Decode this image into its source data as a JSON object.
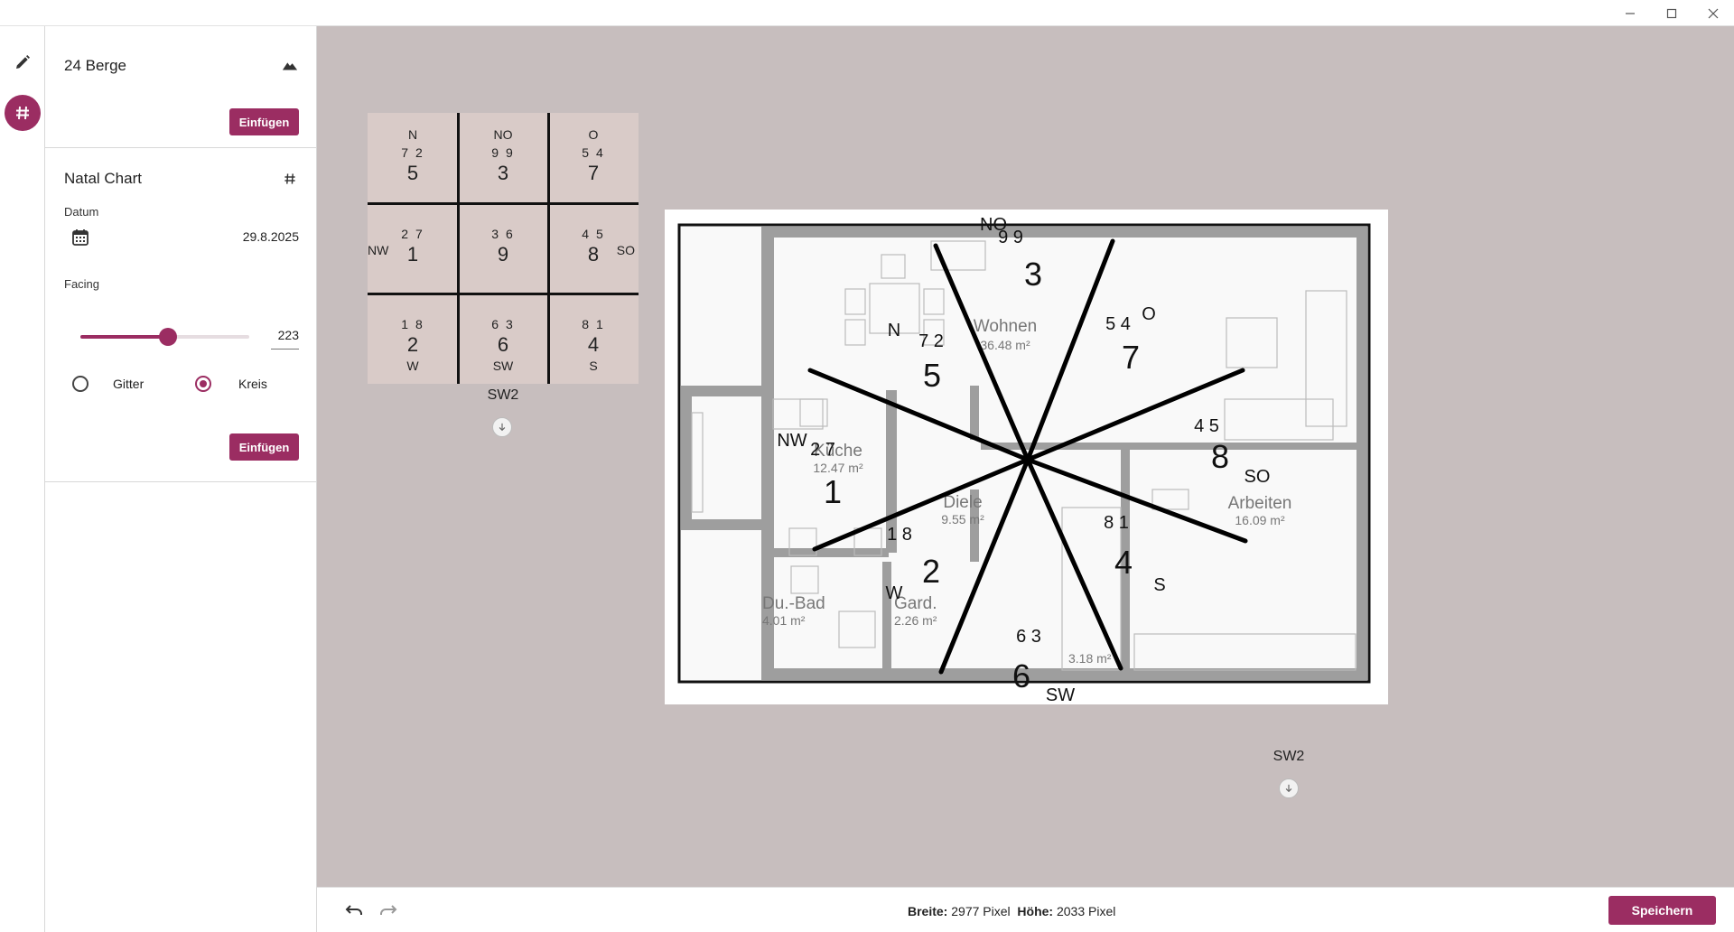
{
  "window": {
    "minimize_icon": "minimize-icon",
    "maximize_icon": "maximize-icon",
    "close_icon": "close-icon"
  },
  "rail": {
    "items": [
      {
        "icon": "pencil-icon",
        "active": false
      },
      {
        "icon": "hashtag-icon",
        "active": true
      }
    ]
  },
  "panel": {
    "berge": {
      "title": "24 Berge",
      "icon": "mountain-icon",
      "insert_label": "Einfügen"
    },
    "natal": {
      "title": "Natal Chart",
      "icon": "hashtag-icon",
      "date_label": "Datum",
      "date_value": "29.8.2025",
      "calendar_icon": "calendar-icon",
      "facing_label": "Facing",
      "facing_value": "223",
      "facing_fraction": 0.52,
      "radio_grid_label": "Gitter",
      "radio_circle_label": "Kreis",
      "selected": "Kreis",
      "insert_label": "Einfügen"
    }
  },
  "grid_chart": {
    "caption": "SW2",
    "cells": [
      {
        "dir": "N",
        "small": "7 2",
        "big": "5"
      },
      {
        "dir": "NO",
        "small": "9 9",
        "big": "3"
      },
      {
        "dir": "O",
        "small": "5 4",
        "big": "7"
      },
      {
        "side_left": "NW",
        "small": "2 7",
        "big": "1"
      },
      {
        "small": "3 6",
        "big": "9"
      },
      {
        "side_right": "SO",
        "small": "4 5",
        "big": "8"
      },
      {
        "dir_bottom": "W",
        "small": "1 8",
        "big": "2"
      },
      {
        "dir_bottom": "SW",
        "small": "6 3",
        "big": "6"
      },
      {
        "dir_bottom": "S",
        "small": "8 1",
        "big": "4"
      }
    ]
  },
  "floorplan": {
    "caption": "SW2",
    "rooms": [
      {
        "name": "Wohnen",
        "area": "36.48 m²"
      },
      {
        "name": "Küche",
        "area": "12.47 m²"
      },
      {
        "name": "Diele",
        "area": "9.55 m²"
      },
      {
        "name": "Arbeiten",
        "area": "16.09 m²"
      },
      {
        "name": "Du.-Bad",
        "area": "4.01 m²"
      },
      {
        "name": "Gard.",
        "area": "2.26 m²"
      },
      {
        "name": "",
        "area": "3.18 m²"
      }
    ],
    "sectors": [
      {
        "dir": "NO",
        "small": "9 9",
        "big": "3"
      },
      {
        "dir": "N",
        "small": "7 2",
        "big": "5"
      },
      {
        "dir": "O",
        "small": "5 4",
        "big": "7"
      },
      {
        "dir": "NW",
        "small": "2 7",
        "big": "1"
      },
      {
        "dir": "SO",
        "small": "4 5",
        "big": "8"
      },
      {
        "dir": "W",
        "small": "1 8",
        "big": "2"
      },
      {
        "dir": "S",
        "small": "8 1",
        "big": "4"
      },
      {
        "dir": "SW",
        "small": "6 3",
        "big": "6"
      }
    ]
  },
  "bottombar": {
    "undo_icon": "undo-icon",
    "redo_icon": "redo-icon",
    "width_label": "Breite:",
    "width_value": "2977 Pixel",
    "height_label": "Höhe:",
    "height_value": "2033 Pixel",
    "save_label": "Speichern"
  },
  "colors": {
    "accent": "#9b2d62",
    "canvas": "#c7bebe",
    "grid_cell": "#d9cbc8"
  }
}
